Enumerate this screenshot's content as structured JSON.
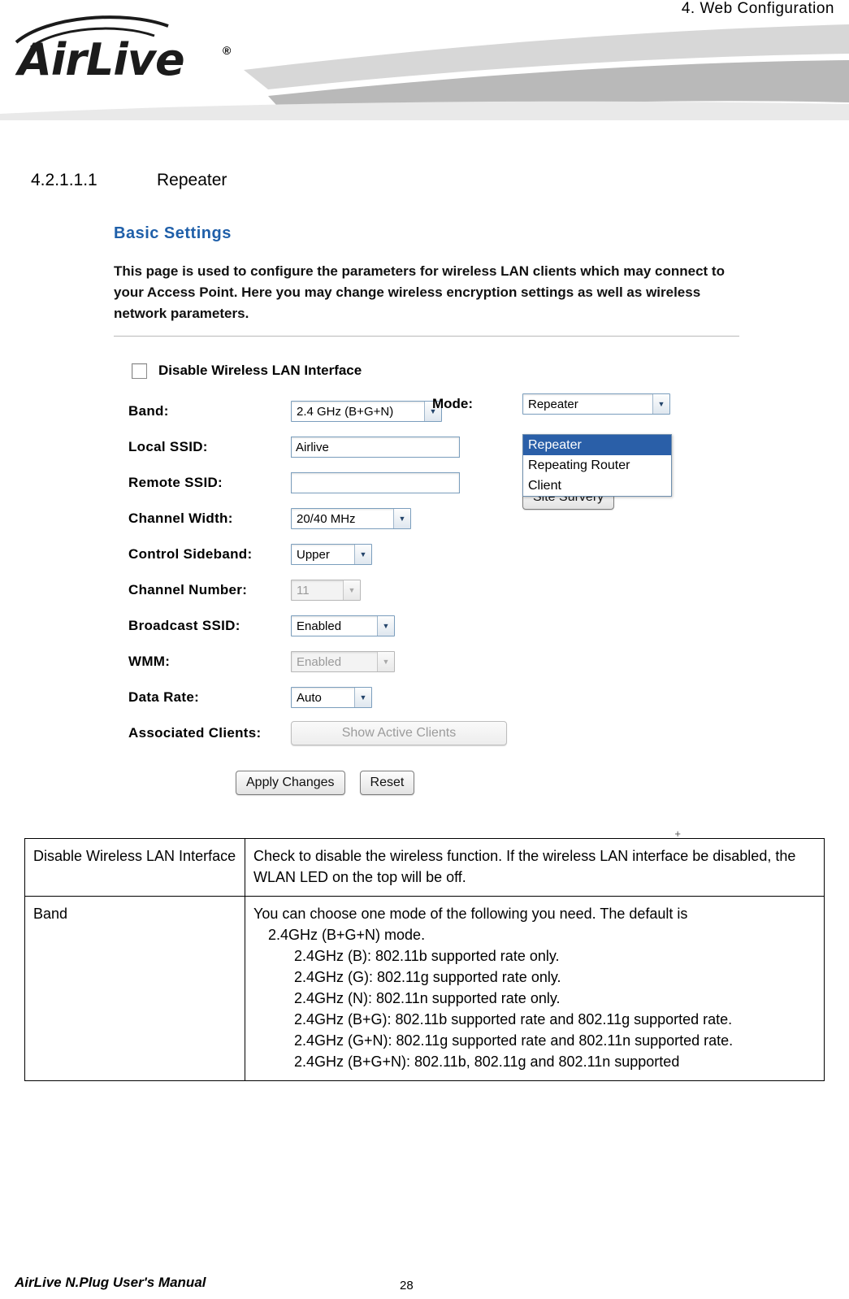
{
  "header": {
    "chapter_title": "4. Web Configuration",
    "logo_text": "AirLive",
    "logo_registered": "®"
  },
  "section": {
    "number": "4.2.1.1.1",
    "title": "Repeater"
  },
  "screenshot": {
    "panel_title": "Basic Settings",
    "description": "This page is used to configure the parameters for wireless LAN clients which may connect to your Access Point. Here you may change wireless encryption settings as well as wireless network parameters.",
    "disable_wireless_label": "Disable Wireless LAN Interface",
    "fields": {
      "band_label": "Band:",
      "band_value": "2.4 GHz (B+G+N)",
      "local_ssid_label": "Local SSID:",
      "local_ssid_value": "Airlive",
      "remote_ssid_label": "Remote SSID:",
      "remote_ssid_value": "",
      "channel_width_label": "Channel Width:",
      "channel_width_value": "20/40 MHz",
      "control_sideband_label": "Control Sideband:",
      "control_sideband_value": "Upper",
      "channel_number_label": "Channel Number:",
      "channel_number_value": "11",
      "broadcast_ssid_label": "Broadcast SSID:",
      "broadcast_ssid_value": "Enabled",
      "wmm_label": "WMM:",
      "wmm_value": "Enabled",
      "data_rate_label": "Data Rate:",
      "data_rate_value": "Auto",
      "associated_clients_label": "Associated Clients:",
      "associated_clients_button": "Show Active Clients",
      "mode_label": "Mode:",
      "mode_value": "Repeater",
      "site_survey_button": "Site Survery"
    },
    "mode_options": [
      "Repeater",
      "Repeating Router",
      "Client"
    ],
    "buttons": {
      "apply": "Apply Changes",
      "reset": "Reset"
    }
  },
  "table": {
    "rows": [
      {
        "key": "Disable Wireless LAN Interface",
        "lines": [
          {
            "text": "Check to disable the wireless function. If the wireless LAN interface be disabled, the WLAN LED on the top will be off.",
            "indent": 0
          }
        ]
      },
      {
        "key": "Band",
        "lines": [
          {
            "text": "You can choose one mode of the following you need. The default is",
            "indent": 0
          },
          {
            "text": "2.4GHz (B+G+N) mode.",
            "indent": 1
          },
          {
            "text": "2.4GHz (B): 802.11b supported rate only.",
            "indent": 2
          },
          {
            "text": "2.4GHz (G): 802.11g supported rate only.",
            "indent": 2
          },
          {
            "text": "2.4GHz (N): 802.11n supported rate only.",
            "indent": 2
          },
          {
            "text": "2.4GHz (B+G): 802.11b supported rate and 802.11g supported rate.",
            "indent": 2
          },
          {
            "text": "2.4GHz (G+N): 802.11g supported rate and 802.11n supported rate.",
            "indent": 2
          },
          {
            "text": "2.4GHz (B+G+N): 802.11b, 802.11g and 802.11n supported",
            "indent": 2
          }
        ]
      }
    ]
  },
  "footer": {
    "manual": "AirLive N.Plug User's Manual",
    "page": "28"
  }
}
